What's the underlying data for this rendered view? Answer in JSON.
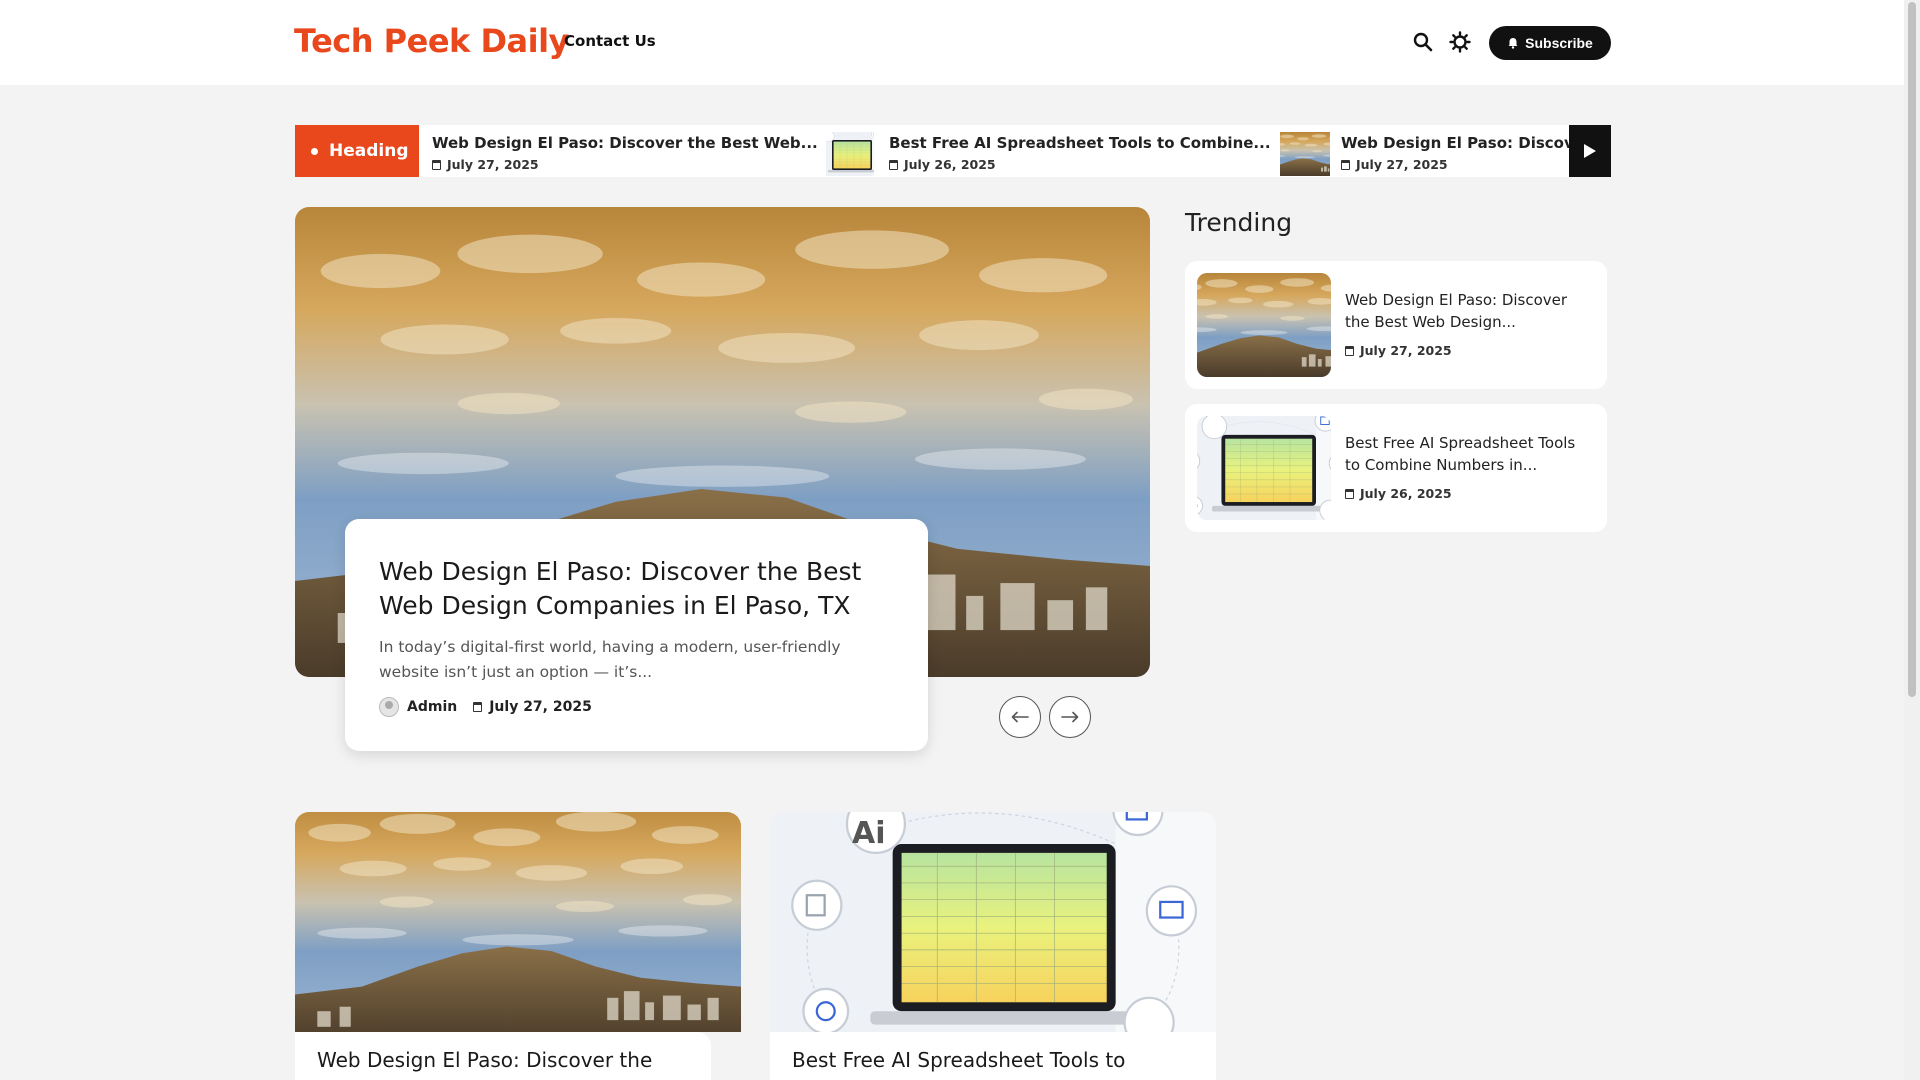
{
  "header": {
    "logo": "Tech Peek Daily",
    "nav": [
      {
        "label": "Contact Us"
      }
    ],
    "subscribe_label": "Subscribe",
    "brand_color": "#e8481c"
  },
  "ticker": {
    "badge": "Heading",
    "items": [
      {
        "title": "Web Design El Paso: Discover the Best Web...",
        "date": "July 27, 2025"
      },
      {
        "title": "Best Free AI Spreadsheet Tools to Combine...",
        "date": "July 26, 2025"
      },
      {
        "title": "Web Design El Paso: Discover",
        "date": "July 27, 2025"
      }
    ]
  },
  "hero": {
    "title": "Web Design El Paso: Discover the Best Web Design Companies in El Paso, TX",
    "excerpt": "In today’s digital-first world, having a modern, user-friendly website isn’t just an option — it’s...",
    "author": "Admin",
    "date": "July 27, 2025"
  },
  "trending": {
    "heading": "Trending",
    "items": [
      {
        "title": "Web Design El Paso: Discover the Best Web Design...",
        "date": "July 27, 2025"
      },
      {
        "title": "Best Free AI Spreadsheet Tools to Combine Numbers in...",
        "date": "July 26, 2025"
      }
    ]
  },
  "posts": [
    {
      "title": "Web Design El Paso: Discover the"
    },
    {
      "title": "Best Free AI Spreadsheet Tools to"
    }
  ],
  "illustration": {
    "ai_label": "Ai"
  }
}
